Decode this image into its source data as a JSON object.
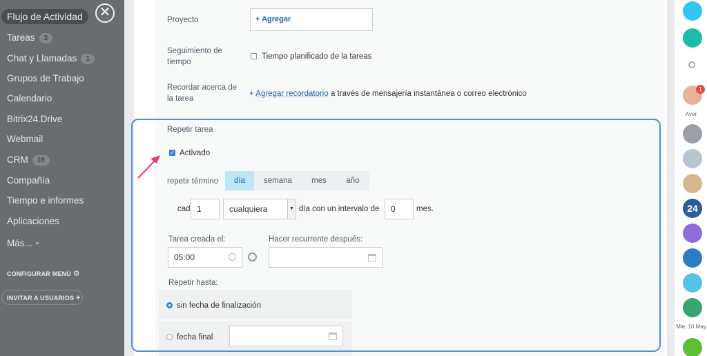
{
  "sidebar": {
    "active": "Flujo de Actividad",
    "items": [
      {
        "label": "Tareas",
        "badge": "3"
      },
      {
        "label": "Chat y Llamadas",
        "badge": "1"
      },
      {
        "label": "Grupos de Trabajo",
        "badge": ""
      },
      {
        "label": "Calendario",
        "badge": ""
      },
      {
        "label": "Bitrix24.Drive",
        "badge": ""
      },
      {
        "label": "Webmail",
        "badge": ""
      },
      {
        "label": "CRM",
        "badge": "18"
      },
      {
        "label": "Compañía",
        "badge": ""
      },
      {
        "label": "Tiempo e informes",
        "badge": ""
      },
      {
        "label": "Aplicaciones",
        "badge": ""
      },
      {
        "label": "Más... ⁃",
        "badge": ""
      }
    ],
    "configure_menu": "CONFIGURAR MENÚ",
    "invite_users": "INVITAR A USUARIOS",
    "close_symbol": "✕"
  },
  "form": {
    "project_label": "Proyecto",
    "project_add": "+ Agregar",
    "tracking_label": "Seguimiento de tiempo",
    "tracking_checkbox": "Tiempo planificado de la tareas",
    "remind_label": "Recordar acerca de la tarea",
    "remind_prefix": "+ ",
    "remind_link": "Agregar recordatorio",
    "remind_suffix": " a través de mensajería instantánea o correo electrónico",
    "repeat_title": "Repetir tarea",
    "activated": "Activado",
    "repeat_term_label": "repetir término",
    "tabs": [
      "día",
      "semana",
      "mes",
      "año"
    ],
    "every_label": "cada",
    "every_value": "1",
    "select_value": "cualquiera",
    "interval_label": "día con un intervalo de",
    "interval_value": "0",
    "months_label": "mes.",
    "created_label": "Tarea creada el:",
    "created_time": "05:00",
    "recurrent_label": "Hacer recurrente después:",
    "repeat_until_label": "Repetir hasta:",
    "no_end": "sin fecha de finalización",
    "end_date": "fecha final"
  },
  "rail": {
    "notification_count": "1",
    "yesterday": "Ayer",
    "day_label": "Mie, 10 May",
    "app_badge": "24"
  },
  "colors": {
    "highlight": "#4a90e2",
    "accent": "#2067b0",
    "arrow": "#e8396f"
  }
}
